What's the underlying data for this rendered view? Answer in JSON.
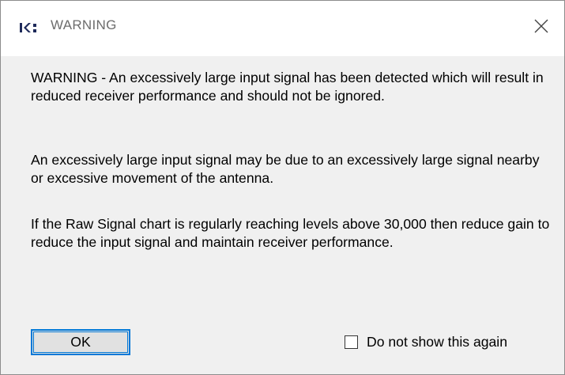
{
  "window": {
    "title": "WARNING",
    "app_icon": "receiver-app-icon",
    "close_icon": "close-icon"
  },
  "message": {
    "paragraph_1": "WARNING - An excessively large input signal has been detected which will result in reduced receiver performance and should not be ignored.",
    "paragraph_2": "An excessively large input signal may be due to an excessively large signal nearby or excessive movement of the antenna.",
    "paragraph_3": "If the Raw Signal chart is regularly reaching levels above 30,000 then reduce gain to reduce the input signal and maintain receiver performance."
  },
  "buttons": {
    "ok_label": "OK"
  },
  "checkbox": {
    "label": "Do not show this again",
    "checked": false
  },
  "colors": {
    "accent": "#0078d7",
    "dialog_bg": "#f0f0f0",
    "titlebar_bg": "#ffffff",
    "title_text": "#6d6d6d",
    "icon_color": "#1e2a5a"
  }
}
